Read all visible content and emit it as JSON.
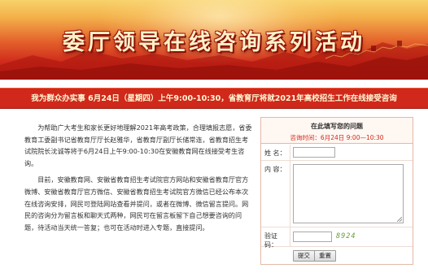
{
  "banner": {
    "title": "委厅领导在线咨询系列活动"
  },
  "notice": {
    "text": "我为群众办实事  6月24日（星期四）上午9:00-10:30，省教育厅将就2021年高校招生工作在线接受咨询"
  },
  "article": {
    "paragraphs": [
      "为帮助广大考生和家长更好地理解2021年高考政策，合理填报志愿，省委教育工委副书记省教育厅厅长赵雅华，省教育厅副厅长储常连，省教育招生考试院院长沈诚等将于6月24日上午9:00-10:30在安徽教育网在线接受考生咨询。",
      "目前，安徽教育网、安徽省教育招生考试院官方网站和安徽省教育厅官方微博、安徽省教育厅官方微信、安徽省教育招生考试院官方微信已经公布本次在线咨询安排，网民可登陆网站查看并提问，或者在微博、微信留言提问。网民的咨询分为留言板和聊天式两种，网民可在留言板留下自己想要咨询的问题，待活动当天统一答复；也可在活动时进入专题，直接提问。"
    ]
  },
  "panel": {
    "title": "在此填写您的问题",
    "time_prefix": "咨询时间：",
    "time_value": "6月24日 9:00—10:30",
    "name_label": "姓 名：",
    "content_label": "内 容：",
    "code_label": "验证码：",
    "code_value": "8924",
    "name_value": "",
    "content_value": "",
    "code_input_value": "",
    "submit_label": "提交",
    "reset_label": "重置"
  },
  "colors": {
    "banner_red": "#c01912",
    "notice_bg": "#d0281a",
    "notice_text": "#fff8d6",
    "time_text": "#d2281b",
    "panel_border": "#e3b9a8",
    "code_text": "#6a9a3a"
  }
}
